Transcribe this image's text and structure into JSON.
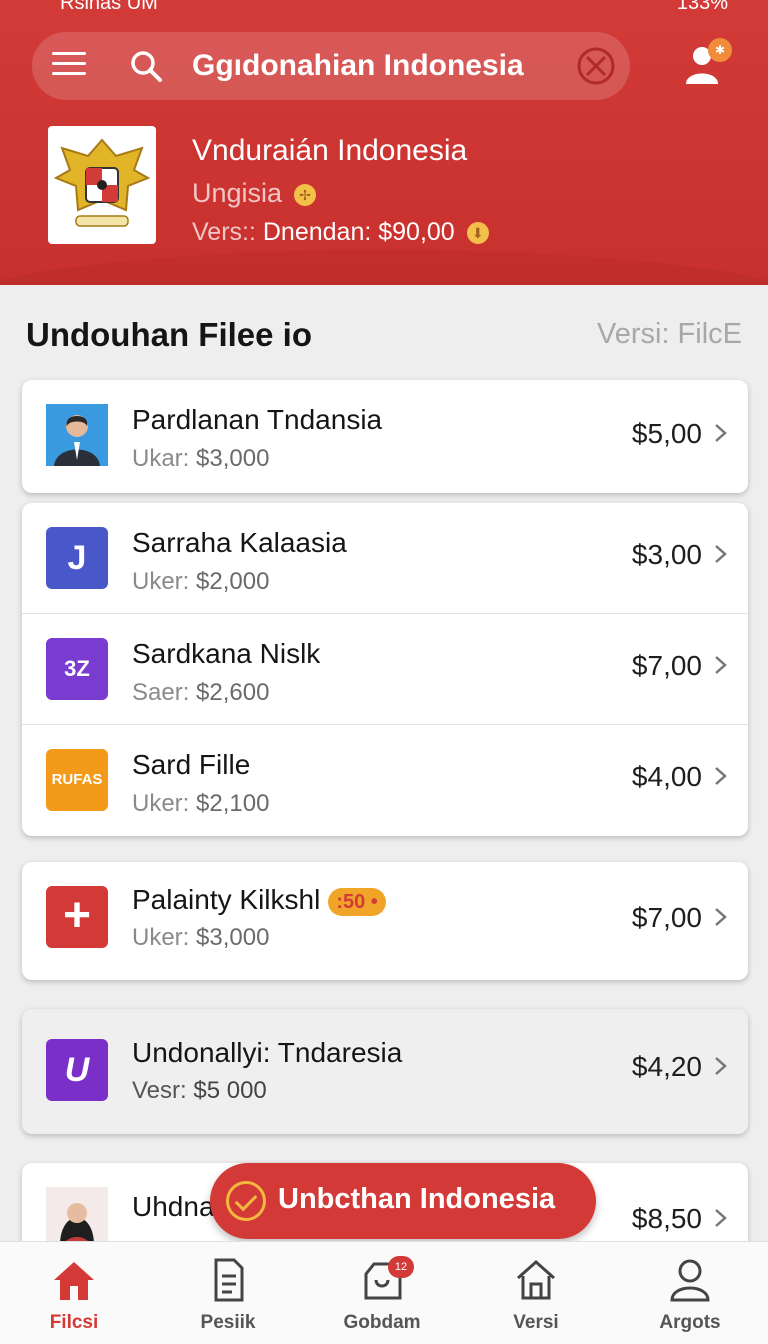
{
  "status_bar": {
    "left": "Rsinas UM",
    "battery": "133%"
  },
  "search": {
    "query": "Ggıdonahian Indonesia"
  },
  "app": {
    "title": "Vnduraián Indonesia",
    "subtitle": "Ungisia",
    "version_label": "Vers::",
    "version_value": "Dnendan: $90,00"
  },
  "section": {
    "title": "Undouhan Filee io",
    "right": "Versi: FilcE"
  },
  "items": [
    {
      "name": "Pardlanan Tndansia",
      "sub_label": "Ukar:",
      "sub_value": "$3,000",
      "price": "$5,00",
      "icon": "person-photo-icon"
    },
    {
      "name": "Sarraha Kalaasia",
      "sub_label": "Uker:",
      "sub_value": "$2,000",
      "price": "$3,00",
      "icon": "J",
      "color": "#4a57c9"
    },
    {
      "name": "Sardkana Nislk",
      "sub_label": "Saer:",
      "sub_value": "$2,600",
      "price": "$7,00",
      "icon": "3Z",
      "color": "#7a3bd1"
    },
    {
      "name": "Sard Fille",
      "sub_label": "Uker:",
      "sub_value": "$2,100",
      "price": "$4,00",
      "icon": "RUFAS",
      "color": "#f39a1a"
    },
    {
      "name": "Palainty Kilkshl",
      "sub_label": "Uker:",
      "sub_value": "$3,000",
      "price": "$7,00",
      "icon": "+",
      "color": "#d33a37",
      "badge": "⁠:50 •"
    },
    {
      "name": "Undonallyi: Tndaresia",
      "sub_label": "Vesr:",
      "sub_value": "$5 000",
      "price": "$4,20",
      "icon": "U",
      "color": "#7b2fc9"
    },
    {
      "name": "Uhdna",
      "price": "$8,50",
      "icon": "person-photo-icon"
    }
  ],
  "toast": {
    "text": "Unbcthan Indonesia"
  },
  "nav": [
    {
      "label": "Filcsi",
      "icon": "home-icon",
      "active": true
    },
    {
      "label": "Pesiik",
      "icon": "document-icon"
    },
    {
      "label": "Gobdam",
      "icon": "shopping-bag-icon",
      "badge": "12"
    },
    {
      "label": "Versi",
      "icon": "house-outline-icon"
    },
    {
      "label": "Argots",
      "icon": "user-icon"
    }
  ],
  "colors": {
    "primary": "#d23b38",
    "accent": "#f3b93e",
    "background": "#eeeeee"
  }
}
